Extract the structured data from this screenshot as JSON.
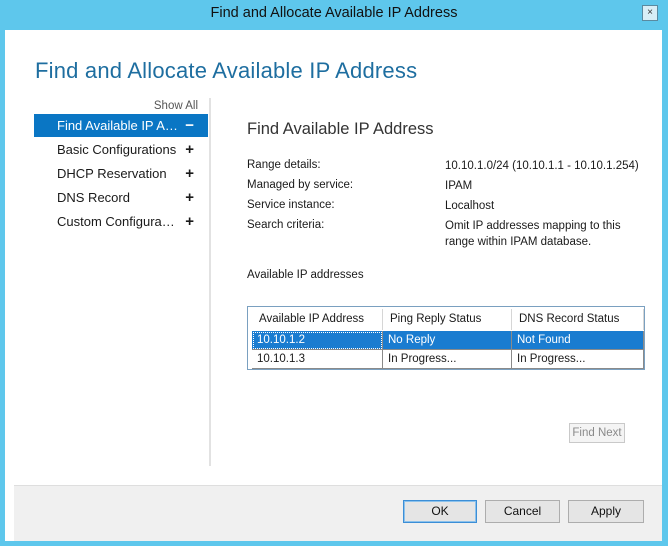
{
  "window": {
    "title": "Find and Allocate Available IP Address",
    "close_glyph": "×"
  },
  "dialog": {
    "heading": "Find and Allocate Available IP Address"
  },
  "nav": {
    "show_all": "Show All",
    "items": [
      {
        "label": "Find Available IP A…",
        "sign": "−",
        "active": true
      },
      {
        "label": "Basic Configurations",
        "sign": "+",
        "active": false
      },
      {
        "label": "DHCP Reservation",
        "sign": "+",
        "active": false
      },
      {
        "label": "DNS Record",
        "sign": "+",
        "active": false
      },
      {
        "label": "Custom Configura…",
        "sign": "+",
        "active": false
      }
    ]
  },
  "content": {
    "title": "Find Available IP Address",
    "details": [
      {
        "label": "Range details:",
        "value": "10.10.1.0/24 (10.10.1.1 - 10.10.1.254)"
      },
      {
        "label": "Managed by service:",
        "value": "IPAM"
      },
      {
        "label": "Service instance:",
        "value": "Localhost"
      },
      {
        "label": "Search criteria:",
        "value": "Omit IP addresses mapping to this range within IPAM database."
      }
    ],
    "ip_caption": "Available IP addresses"
  },
  "grid": {
    "columns": [
      "Available IP Address",
      "Ping Reply Status",
      "DNS Record Status"
    ],
    "rows": [
      [
        "10.10.1.2",
        "No Reply",
        "Not Found"
      ],
      [
        "10.10.1.3",
        "In Progress...",
        "In Progress..."
      ]
    ],
    "selected_row": 0
  },
  "find_next_label": "Find Next",
  "footer": {
    "ok": "OK",
    "cancel": "Cancel",
    "apply": "Apply"
  },
  "colors": {
    "title_bar": "#5ec7ec",
    "heading": "#1e6ea0",
    "selection": "#0a76c4"
  }
}
